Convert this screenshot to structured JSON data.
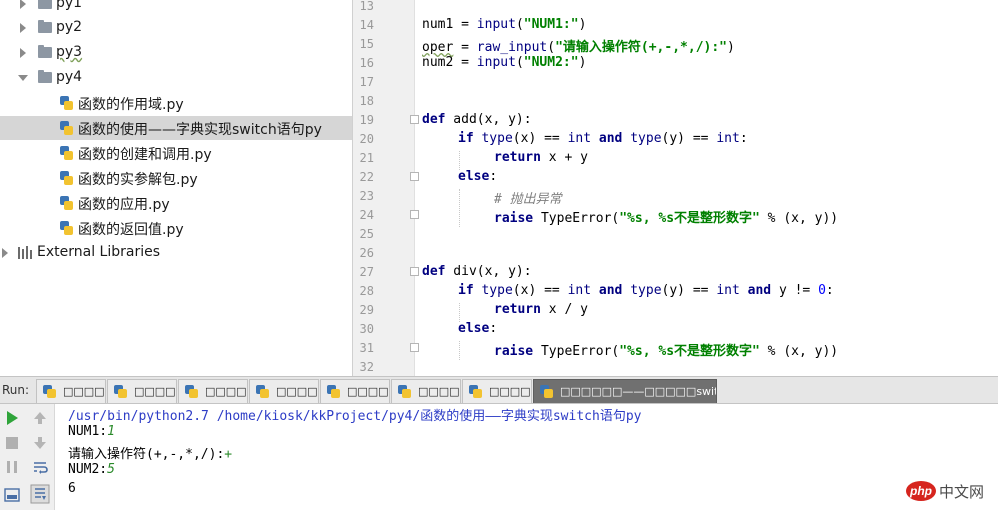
{
  "project_tree": {
    "folders": [
      "py1",
      "py2",
      "py3",
      "py4"
    ],
    "files": [
      "函数的作用域.py",
      "函数的使用——字典实现switch语句py",
      "函数的创建和调用.py",
      "函数的实参解包.py",
      "函数的应用.py",
      "函数的返回值.py"
    ],
    "selected_file": "函数的使用——字典实现switch语句py",
    "external_libraries": "External Libraries"
  },
  "editor": {
    "line_numbers": [
      "13",
      "14",
      "15",
      "16",
      "17",
      "18",
      "19",
      "20",
      "21",
      "22",
      "23",
      "24",
      "25",
      "26",
      "27",
      "28",
      "29",
      "30",
      "31",
      "32"
    ],
    "lines": {
      "l14": {
        "a": "num1 = ",
        "b": "input",
        "c": "(",
        "d": "\"NUM1:\"",
        "e": ")"
      },
      "l15": {
        "a": "oper",
        "b": " = ",
        "c": "raw_input",
        "d": "(",
        "e": "\"请输入操作符(+,-,*,/):\"",
        "f": ")"
      },
      "l16": {
        "a": "num2 = ",
        "b": "input",
        "c": "(",
        "d": "\"NUM2:\"",
        "e": ")"
      },
      "l19": {
        "a": "def",
        "b": " add(x, y):"
      },
      "l20": {
        "a": "if",
        "b": " ",
        "c": "type",
        "d": "(x) == ",
        "e": "int",
        "f": " ",
        "g": "and",
        "h": " ",
        "i": "type",
        "j": "(y) == ",
        "k": "int",
        "l": ":"
      },
      "l21": {
        "a": "return",
        "b": " x + y"
      },
      "l22": {
        "a": "else",
        "b": ":"
      },
      "l23": {
        "a": "# 抛出异常"
      },
      "l24": {
        "a": "raise",
        "b": " TypeError(",
        "c": "\"%s, %s不是整形数字\"",
        "d": " % (x, y))"
      },
      "l27": {
        "a": "def",
        "b": " div(x, y):"
      },
      "l28": {
        "a": "if",
        "b": " ",
        "c": "type",
        "d": "(x) == ",
        "e": "int",
        "f": " ",
        "g": "and",
        "h": " ",
        "i": "type",
        "j": "(y) == ",
        "k": "int",
        "l": " ",
        "m": "and",
        "n": " y != ",
        "o": "0",
        "p": ":"
      },
      "l29": {
        "a": "return",
        "b": " x / y"
      },
      "l30": {
        "a": "else",
        "b": ":"
      },
      "l31": {
        "a": "raise",
        "b": " TypeError(",
        "c": "\"%s, %s不是整形数字\"",
        "d": " % (x, y))"
      }
    }
  },
  "run_panel": {
    "label": "Run:",
    "tabs": [
      "□□□□□□",
      "□□□□□□",
      "□□□□□□",
      "□□□□□□",
      "□□□□□□",
      "□□□□□□",
      "□□□□□□",
      "□□□□□□——□□□□□switch□□py"
    ],
    "active_tab_index": 7
  },
  "console": {
    "command_path": "/usr/bin/python2.7 /home/kiosk/kkProject/py4/函数的使用——字典实现switch语句py",
    "l1_prompt": "NUM1:",
    "l1_input": "1",
    "l2_prompt": "请输入操作符(+,-,*,/):",
    "l2_input": "+",
    "l3_prompt": "NUM2:",
    "l3_input": "5",
    "result": "6"
  },
  "watermark": {
    "logo": "php",
    "text": "中文网"
  },
  "colors": {
    "keyword": "#000080",
    "string": "#008000",
    "comment": "#808080",
    "number": "#0000ff",
    "console_path": "#2d3cc6",
    "console_input": "#2a8a2a",
    "active_tab": "#707070"
  }
}
